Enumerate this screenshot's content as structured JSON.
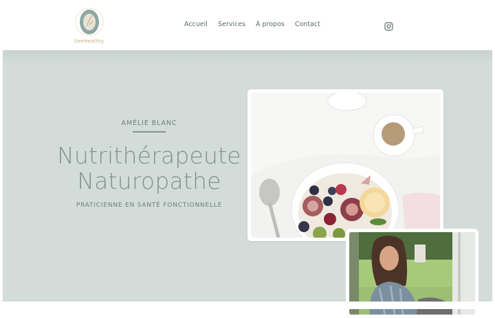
{
  "brand": {
    "name": "SeeHealthy"
  },
  "nav": {
    "items": [
      "Accueil",
      "Services",
      "À propos",
      "Contact"
    ]
  },
  "social": {
    "icon": "instagram-icon"
  },
  "hero": {
    "name": "AMÉLIE BLANC",
    "title_line1": "Nutrithérapeute",
    "title_line2": "Naturopathe",
    "subtitle": "PRATICIENNE EN SANTÉ FONCTIONNELLE"
  },
  "colors": {
    "hero_bg": "#d4dcd9",
    "accent": "#7c948f",
    "logo_gold": "#c9a77a"
  }
}
